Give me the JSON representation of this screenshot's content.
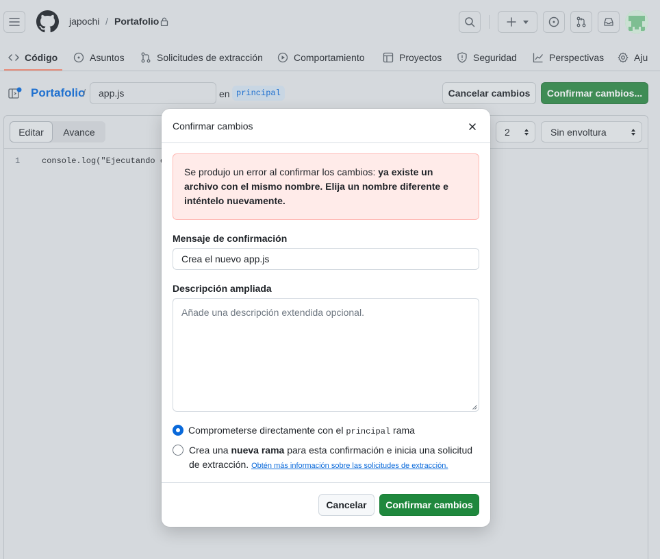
{
  "topbar": {
    "owner": "japochi",
    "separator": "/",
    "repo": "Portafolio",
    "plus_label": "+"
  },
  "tabs": [
    {
      "label": "Código",
      "icon": "code-icon"
    },
    {
      "label": "Asuntos",
      "icon": "issue-icon"
    },
    {
      "label": "Solicitudes de extracción",
      "icon": "pull-request-icon"
    },
    {
      "label": "Comportamiento",
      "icon": "play-icon"
    },
    {
      "label": "Proyectos",
      "icon": "table-icon"
    },
    {
      "label": "Seguridad",
      "icon": "shield-icon"
    },
    {
      "label": "Perspectivas",
      "icon": "graph-icon"
    },
    {
      "label": "Aju",
      "icon": "gear-icon"
    }
  ],
  "subbar": {
    "repo_link": "Portafolio",
    "slash": "/",
    "filename": "app.js",
    "in_label": "en",
    "branch": "principal",
    "cancel_label": "Cancelar cambios",
    "commit_label": "Confirmar cambios..."
  },
  "editor": {
    "tab_edit": "Editar",
    "tab_preview": "Avance",
    "indent_value": "2",
    "wrap_value": "Sin envoltura",
    "line_number": "1",
    "code_line": "console.log(\"Ejecutando el"
  },
  "modal": {
    "title": "Confirmar cambios",
    "error_prefix": "Se produjo un error al confirmar los cambios: ",
    "error_bold": "ya existe un archivo con el mismo nombre. Elija un nombre diferente e inténtelo nuevamente.",
    "message_label": "Mensaje de confirmación",
    "message_value": "Crea el nuevo app.js",
    "description_label": "Descripción ampliada",
    "description_placeholder": "Añade una descripción extendida opcional.",
    "option1_prefix": "Comprometerse directamente con el ",
    "option1_branch": "principal",
    "option1_suffix": " rama",
    "option2_prefix": "Crea una ",
    "option2_bold": "nueva rama",
    "option2_suffix": " para esta confirmación e inicia una solicitud de extracción. ",
    "option2_link": "Obtén más información sobre las solicitudes de extracción.",
    "cancel_label": "Cancelar",
    "confirm_label": "Confirmar cambios"
  },
  "colors": {
    "primary": "#1f883d",
    "accent_underline": "#fd8c73",
    "error_bg": "#ffebe9",
    "link": "#0969da"
  }
}
